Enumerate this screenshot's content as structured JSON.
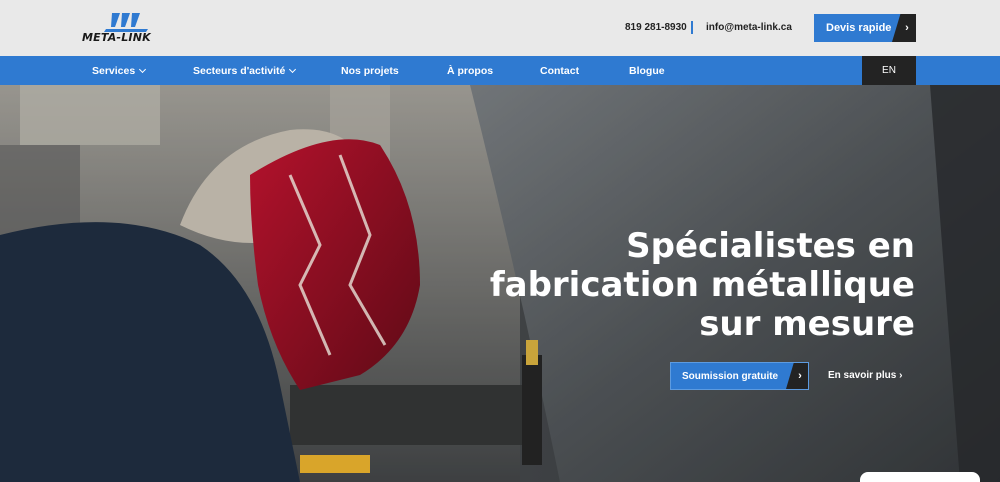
{
  "brand": {
    "name": "META-LINK"
  },
  "header": {
    "phone": "819 281-8930",
    "email": "info@meta-link.ca",
    "quote_button": "Devis rapide"
  },
  "nav": {
    "items": [
      {
        "label": "Services",
        "dropdown": true
      },
      {
        "label": "Secteurs d'activité",
        "dropdown": true
      },
      {
        "label": "Nos projets",
        "dropdown": false
      },
      {
        "label": "À propos",
        "dropdown": false
      },
      {
        "label": "Contact",
        "dropdown": false
      },
      {
        "label": "Blogue",
        "dropdown": false
      }
    ],
    "language": "EN"
  },
  "hero": {
    "title_line1": "Spécialistes en",
    "title_line2": "fabrication métallique",
    "title_line3": "sur mesure",
    "primary_cta": "Soumission gratuite",
    "secondary_cta": "En savoir plus"
  },
  "colors": {
    "accent": "#2f7ad1",
    "dark": "#232323",
    "topbar_bg": "#e9e9e9"
  },
  "icons": {
    "arrow": "chevron-right-icon",
    "dropdown": "chevron-down-icon"
  }
}
